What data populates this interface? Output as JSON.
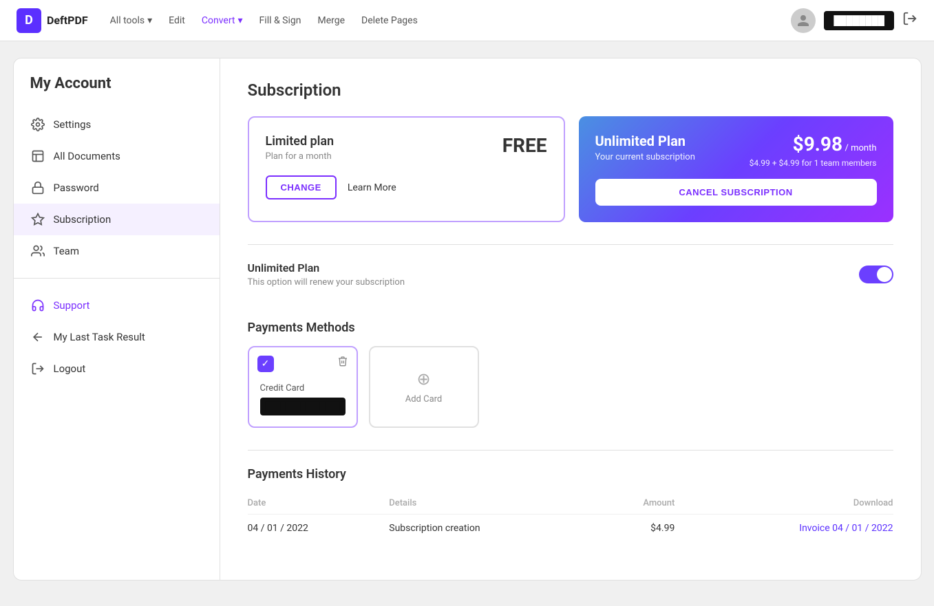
{
  "header": {
    "logo_letter": "D",
    "logo_name": "DeftPDF",
    "nav": [
      {
        "id": "all-tools",
        "label": "All tools",
        "hasDropdown": true
      },
      {
        "id": "edit",
        "label": "Edit",
        "hasDropdown": false
      },
      {
        "id": "convert",
        "label": "Convert",
        "hasDropdown": true
      },
      {
        "id": "fill-sign",
        "label": "Fill & Sign",
        "hasDropdown": false
      },
      {
        "id": "merge",
        "label": "Merge",
        "hasDropdown": false
      },
      {
        "id": "delete-pages",
        "label": "Delete Pages",
        "hasDropdown": false
      }
    ],
    "user_name_placeholder": "████████",
    "logout_label": "→"
  },
  "sidebar": {
    "title": "My Account",
    "items": [
      {
        "id": "settings",
        "label": "Settings",
        "icon": "gear"
      },
      {
        "id": "all-documents",
        "label": "All Documents",
        "icon": "document"
      },
      {
        "id": "password",
        "label": "Password",
        "icon": "lock"
      },
      {
        "id": "subscription",
        "label": "Subscription",
        "icon": "star",
        "active": true
      },
      {
        "id": "team",
        "label": "Team",
        "icon": "team"
      }
    ],
    "bottom_items": [
      {
        "id": "support",
        "label": "Support",
        "icon": "headset",
        "purple": true
      },
      {
        "id": "last-task",
        "label": "My Last Task Result",
        "icon": "arrow-left"
      },
      {
        "id": "logout",
        "label": "Logout",
        "icon": "logout"
      }
    ]
  },
  "content": {
    "title": "Subscription",
    "free_plan": {
      "name": "Limited plan",
      "description": "Plan for a month",
      "price": "FREE",
      "change_label": "CHANGE",
      "learn_more_label": "Learn More"
    },
    "unlimited_plan": {
      "name": "Unlimited Plan",
      "current_sub_label": "Your current subscription",
      "price_main": "$9.98",
      "price_period": "/ month",
      "price_breakdown": "$4.99  +  $4.99 for  1  team members",
      "cancel_label": "CANCEL SUBSCRIPTION"
    },
    "renewal": {
      "title": "Unlimited Plan",
      "description": "This option will renew your subscription",
      "toggle_on": true
    },
    "payments_methods": {
      "section_title": "Payments Methods",
      "credit_card_label": "Credit Card",
      "credit_card_number": "████████████████",
      "add_card_label": "Add Card"
    },
    "payments_history": {
      "section_title": "Payments History",
      "columns": [
        {
          "id": "date",
          "label": "Date"
        },
        {
          "id": "details",
          "label": "Details"
        },
        {
          "id": "amount",
          "label": "Amount"
        },
        {
          "id": "download",
          "label": "Download"
        }
      ],
      "rows": [
        {
          "date": "04 / 01 / 2022",
          "details": "Subscription creation",
          "amount": "$4.99",
          "download": "Invoice 04 / 01 / 2022"
        }
      ]
    }
  }
}
